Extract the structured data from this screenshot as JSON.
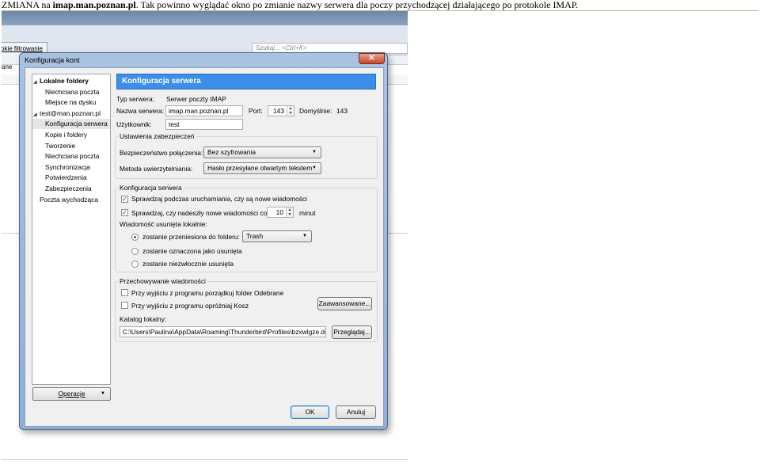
{
  "caption": {
    "lead": "ZMIANA na ",
    "bold": "imap.man.poznan.pl",
    "rest": ". Tak powinno wyglądać okno po zmianie nazwy serwera dla poczy przychodzącej działającego po protokole IMAP."
  },
  "background_app": {
    "filter_tab": "okie filtrowanie",
    "search_placeholder": "Szukaj... <Ctrl+K>",
    "sidebar_label": "ane"
  },
  "dialog": {
    "title": "Konfiguracja kont",
    "close_glyph": "✕",
    "tree": [
      {
        "label": "Lokalne foldery",
        "level": 0,
        "expanded": true,
        "bold": true
      },
      {
        "label": "Niechciana poczta",
        "level": 1
      },
      {
        "label": "Miejsce na dysku",
        "level": 1
      },
      {
        "label": "test@man.poznan.pl",
        "level": 0,
        "expanded": true
      },
      {
        "label": "Konfiguracja serwera",
        "level": 1,
        "selected": true
      },
      {
        "label": "Kopie i foldery",
        "level": 1
      },
      {
        "label": "Tworzenie",
        "level": 1
      },
      {
        "label": "Niechciana poczta",
        "level": 1
      },
      {
        "label": "Synchronizacja",
        "level": 1
      },
      {
        "label": "Potwierdzenia",
        "level": 1
      },
      {
        "label": "Zabezpieczenia",
        "level": 1
      },
      {
        "label": "Poczta wychodząca",
        "level": 0
      }
    ],
    "operations_button": "Operacje",
    "panel_title": "Konfiguracja serwera",
    "server_type_label": "Typ serwera:",
    "server_type_value": "Serwer poczty IMAP",
    "server_name_label": "Nazwa serwera:",
    "server_name_value": "imap.man.poznan.pl",
    "port_label": "Port:",
    "port_value": "143",
    "default_label": "Domyślnie:",
    "default_value": "143",
    "user_label": "Użytkownik:",
    "user_value": "test",
    "security_group": {
      "title": "Ustawienia zabezpieczeń",
      "connection_label": "Bezpieczeństwo połączenia:",
      "connection_value": "Bez szyfrowania",
      "auth_label": "Metoda uwierzytelniania:",
      "auth_value": "Hasło przesyłane otwartym tekstem"
    },
    "server_group": {
      "title": "Konfiguracja serwera",
      "check_startup": "Sprawdzaj podczas uruchamiania, czy są nowe wiadomości",
      "check_startup_checked": true,
      "check_every_prefix": "Sprawdzaj, czy nadeszły nowe wiadomości co",
      "check_every_checked": true,
      "check_every_value": "10",
      "check_every_unit": "minut",
      "deleted_label": "Wiadomość usunięta lokalnie:",
      "radio_move": "zostanie przeniesiona do folderu:",
      "radio_move_selected": true,
      "trash_folder": "Trash",
      "radio_mark": "zostanie oznaczona jako usunięta",
      "radio_delete": "zostanie niezwłocznie usunięta"
    },
    "storage_group": {
      "title": "Przechowywanie wiadomości",
      "compact_inbox": "Przy wyjściu z programu porządkuj folder Odebrane",
      "compact_inbox_checked": false,
      "empty_trash": "Przy wyjściu z programu opróżniaj Kosz",
      "empty_trash_checked": false,
      "advanced_button": "Zaawansowane...",
      "local_dir_label": "Katalog lokalny:",
      "local_dir_value": "C:\\Users\\Paulina\\AppData\\Roaming\\Thunderbird\\Profiles\\bzxwlgze.def",
      "browse_button": "Przeglądaj..."
    },
    "ok_button": "OK",
    "cancel_button": "Anuluj"
  }
}
